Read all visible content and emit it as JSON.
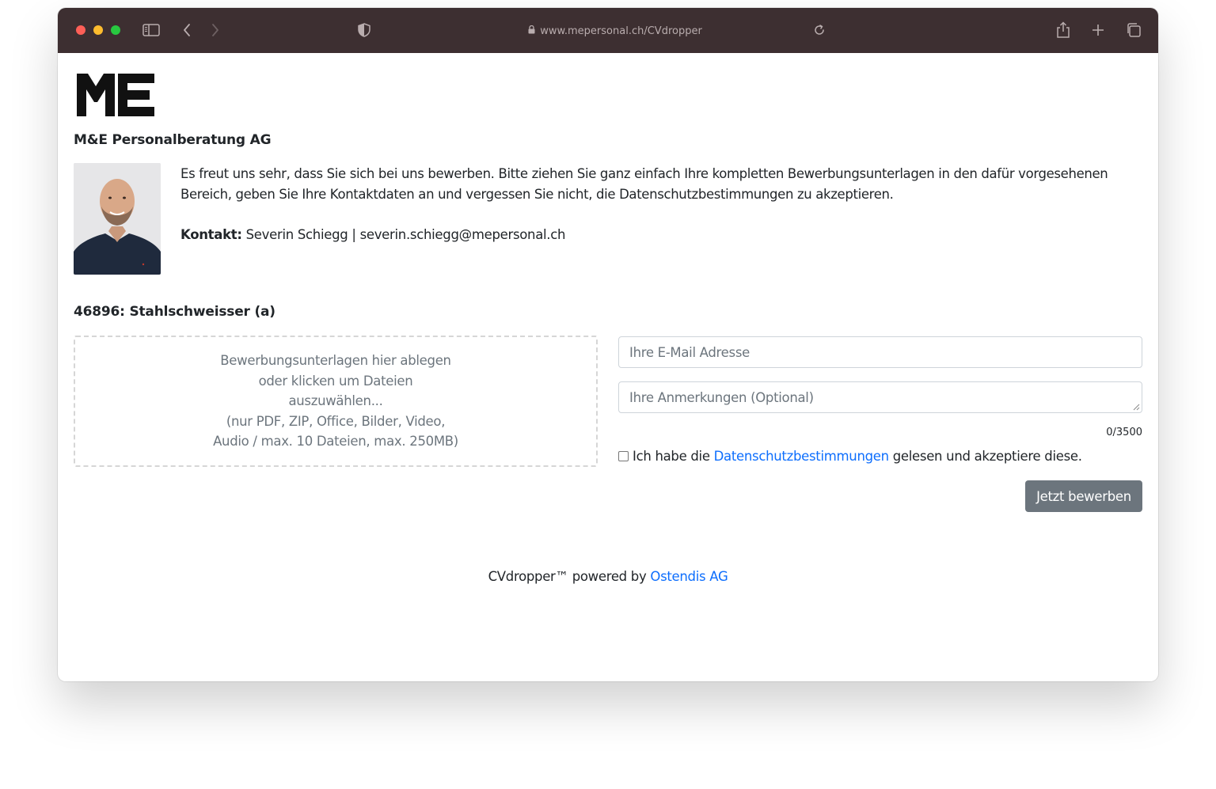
{
  "browser": {
    "url": "www.mepersonal.ch/CVdropper",
    "icons": [
      "sidebar-icon",
      "back-icon",
      "forward-icon",
      "shield-icon",
      "lock-icon",
      "reload-icon",
      "share-icon",
      "plus-icon",
      "tabs-icon"
    ]
  },
  "logo": {
    "text": "ME"
  },
  "company": "M&E Personalberatung AG",
  "intro": {
    "text": "Es freut uns sehr, dass Sie sich bei uns bewerben. Bitte ziehen Sie ganz einfach Ihre kompletten Bewerbungsunterlagen in den dafür vorgesehenen Bereich, geben Sie Ihre Kontaktdaten an und vergessen Sie nicht, die Datenschutzbestimmungen zu akzeptieren.",
    "contact_label": "Kontakt:",
    "contact_value": "Severin Schiegg | severin.schiegg@mepersonal.ch"
  },
  "job": {
    "title": "46896: Stahlschweisser (a)"
  },
  "dropzone": {
    "line1": "Bewerbungsunterlagen hier ablegen",
    "line2": "oder klicken um Dateien",
    "line3": "auszuwählen...",
    "line4": "(nur PDF, ZIP, Office, Bilder, Video,",
    "line5": "Audio / max. 10 Dateien, max. 250MB)"
  },
  "form": {
    "email_placeholder": "Ihre E-Mail Adresse",
    "remarks_placeholder": "Ihre Anmerkungen (Optional)",
    "counter": "0/3500",
    "consent_prefix": "Ich habe die",
    "consent_link": "Datenschutzbestimmungen",
    "consent_suffix": "gelesen und akzeptiere diese.",
    "submit_label": "Jetzt bewerben"
  },
  "footer": {
    "text": "CVdropper™ powered by",
    "link": "Ostendis AG"
  },
  "colors": {
    "titlebar": "#3d2f31",
    "link": "#0d6efd",
    "button": "#6c757d"
  }
}
